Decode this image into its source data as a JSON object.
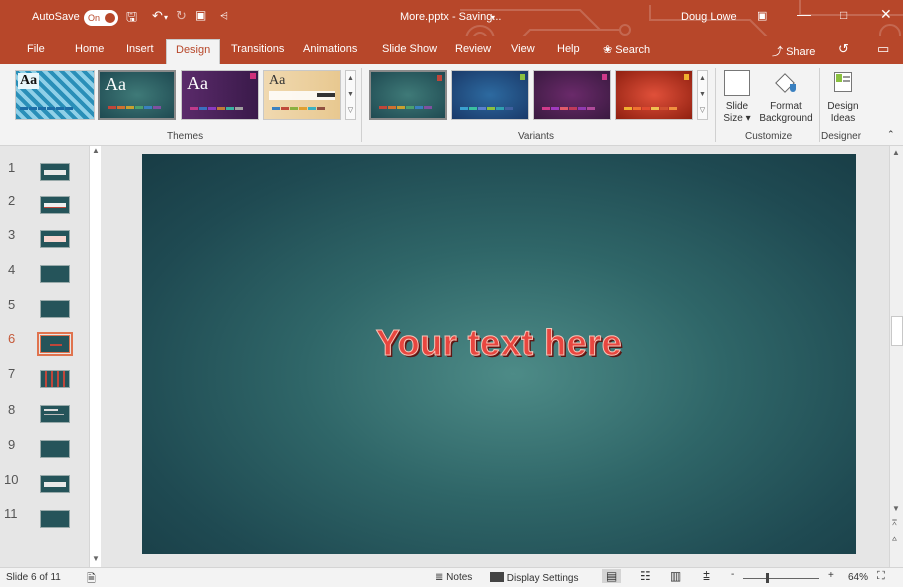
{
  "titlebar": {
    "autosave_label": "AutoSave",
    "autosave_state": "On",
    "doc_title": "More.pptx  -  Saving...",
    "user": "Doug Lowe"
  },
  "tabs": [
    {
      "label": "File"
    },
    {
      "label": "Home"
    },
    {
      "label": "Insert"
    },
    {
      "label": "Design"
    },
    {
      "label": "Transitions"
    },
    {
      "label": "Animations"
    },
    {
      "label": "Slide Show"
    },
    {
      "label": "Review"
    },
    {
      "label": "View"
    },
    {
      "label": "Help"
    },
    {
      "label": "Search"
    }
  ],
  "share_label": "Share",
  "ribbon": {
    "themes_label": "Themes",
    "variants_label": "Variants",
    "customize_label": "Customize",
    "designer_label": "Designer",
    "theme_aa": "Aa",
    "slide_size_label": "Slide",
    "slide_size_label2": "Size",
    "format_bg_label": "Format",
    "format_bg_label2": "Background",
    "design_ideas_label": "Design",
    "design_ideas_label2": "Ideas"
  },
  "slides": [
    {
      "num": "1"
    },
    {
      "num": "2"
    },
    {
      "num": "3"
    },
    {
      "num": "4"
    },
    {
      "num": "5"
    },
    {
      "num": "6"
    },
    {
      "num": "7"
    },
    {
      "num": "8"
    },
    {
      "num": "9"
    },
    {
      "num": "10"
    },
    {
      "num": "11"
    }
  ],
  "slide": {
    "wordart_text": "Your text here"
  },
  "status": {
    "slide_counter": "Slide 6 of 11",
    "notes_label": "Notes",
    "display_settings_label": "Display Settings",
    "zoom_level": "64%",
    "zoom_minus": "-",
    "zoom_plus": "+"
  },
  "colors": {
    "accent": "#b7472a",
    "slide_bg": "#2f6668",
    "wordart": "#e8463f"
  }
}
